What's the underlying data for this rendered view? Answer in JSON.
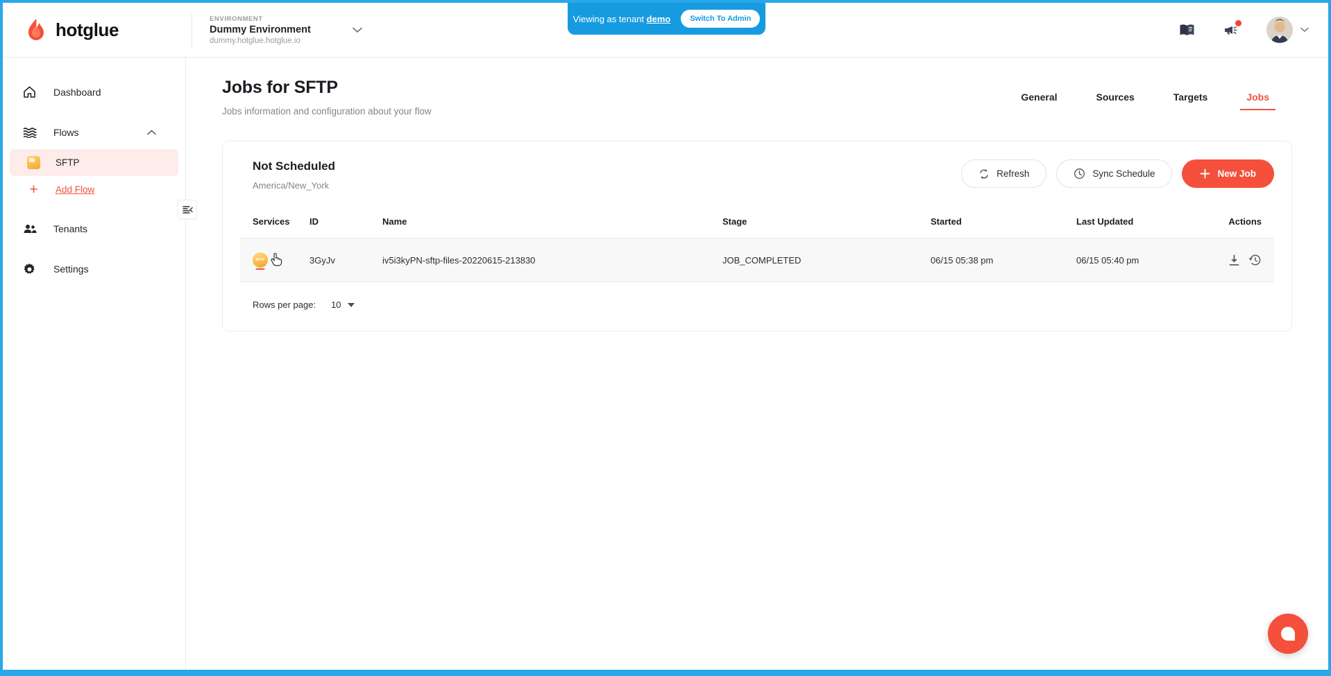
{
  "brand": {
    "name": "hotglue",
    "logo_icon": "flame-icon"
  },
  "environment": {
    "label": "ENVIRONMENT",
    "name": "Dummy Environment",
    "host": "dummy.hotglue.hotglue.io",
    "chevron_icon": "chevron-down-icon"
  },
  "tenant_banner": {
    "prefix": "Viewing as tenant ",
    "tenant": "demo",
    "switch_label": "Switch To Admin",
    "background": "#169be0"
  },
  "topbar_icons": {
    "docs": "book-icon",
    "announcements": "megaphone-icon",
    "avatar": "user-avatar",
    "account_chevron": "chevron-down-icon"
  },
  "sidebar": {
    "items": [
      {
        "label": "Dashboard",
        "icon": "home-icon"
      },
      {
        "label": "Flows",
        "icon": "waves-icon",
        "chevron": "chevron-up-icon"
      },
      {
        "label": "Tenants",
        "icon": "people-icon"
      },
      {
        "label": "Settings",
        "icon": "gear-icon"
      }
    ],
    "flows_children": [
      {
        "label": "SFTP",
        "icon": "sftp-folder-icon",
        "active": true
      },
      {
        "label": "Add Flow",
        "icon": "plus-icon",
        "is_add": true
      }
    ],
    "collapse_toggle_icon": "collapse-sidebar-icon"
  },
  "page": {
    "title": "Jobs for SFTP",
    "subtitle": "Jobs information and configuration about your flow",
    "tabs": [
      {
        "label": "General",
        "active": false
      },
      {
        "label": "Sources",
        "active": false
      },
      {
        "label": "Targets",
        "active": false
      },
      {
        "label": "Jobs",
        "active": true
      }
    ],
    "accent_color": "#f4503c"
  },
  "schedule": {
    "status": "Not Scheduled",
    "timezone": "America/New_York",
    "buttons": {
      "refresh": {
        "label": "Refresh",
        "icon": "refresh-icon"
      },
      "sync_schedule": {
        "label": "Sync Schedule",
        "icon": "clock-icon"
      },
      "new_job": {
        "label": "New Job",
        "icon": "plus-icon"
      }
    }
  },
  "table": {
    "columns": [
      "Services",
      "ID",
      "Name",
      "Stage",
      "Started",
      "Last Updated",
      "Actions"
    ],
    "rows": [
      {
        "service_icon": "sftp-service-icon",
        "service_label": "SFTP",
        "id": "3GyJv",
        "name": "iv5i3kyPN-sftp-files-20220615-213830",
        "stage": "JOB_COMPLETED",
        "started": "06/15 05:38 pm",
        "last_updated": "06/15 05:40 pm",
        "actions": [
          "download-icon",
          "history-icon"
        ]
      }
    ]
  },
  "pagination": {
    "rows_per_page_label": "Rows per page:",
    "rows_per_page_value": "10",
    "caret_icon": "caret-down-icon"
  },
  "chat": {
    "icon": "chat-bubble-icon",
    "color": "#f4503c"
  }
}
